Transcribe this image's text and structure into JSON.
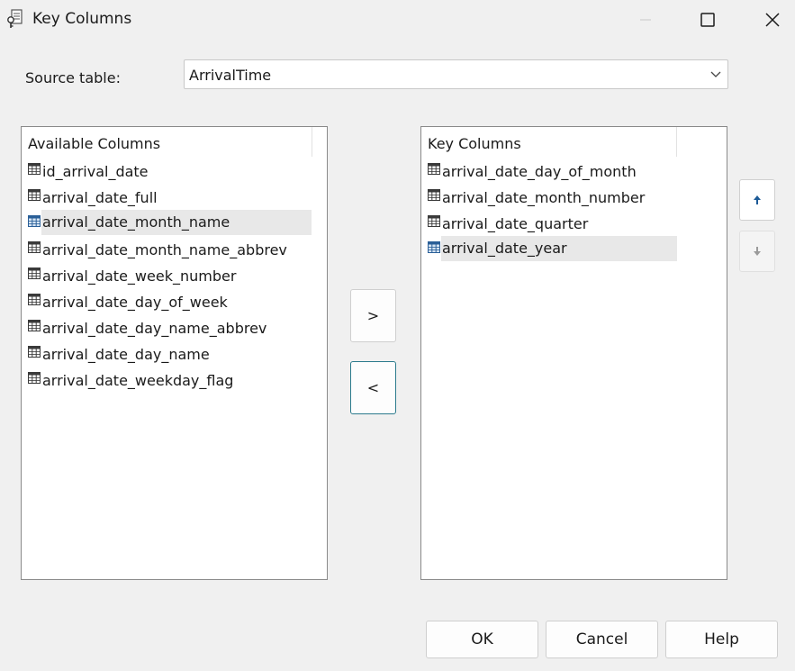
{
  "window": {
    "title": "Key Columns"
  },
  "source": {
    "label": "Source table:",
    "selected": "ArrivalTime"
  },
  "available": {
    "header": "Available Columns",
    "items": [
      "id_arrival_date",
      "arrival_date_full",
      "arrival_date_month_name",
      "arrival_date_month_name_abbrev",
      "arrival_date_week_number",
      "arrival_date_day_of_week",
      "arrival_date_day_name_abbrev",
      "arrival_date_day_name",
      "arrival_date_weekday_flag"
    ],
    "selected_index": 2
  },
  "key": {
    "header": "Key Columns",
    "items": [
      "arrival_date_day_of_month",
      "arrival_date_month_number",
      "arrival_date_quarter",
      "arrival_date_year"
    ],
    "selected_index": 3
  },
  "transfer": {
    "add_label": ">",
    "remove_label": "<"
  },
  "buttons": {
    "ok": "OK",
    "cancel": "Cancel",
    "help": "Help"
  },
  "icons": {
    "app": "key-table-icon",
    "column": "column-icon",
    "column_selected": "column-selected-icon",
    "move_up": "arrow-up-icon",
    "move_down": "arrow-down-icon"
  },
  "colors": {
    "selection_bg": "#e8e8e8",
    "icon_blue": "#2a5f98",
    "arrow_up_blue": "#1c5a97",
    "arrow_down_gray": "#9a9a9a",
    "focus_border": "#2b7a8c"
  }
}
